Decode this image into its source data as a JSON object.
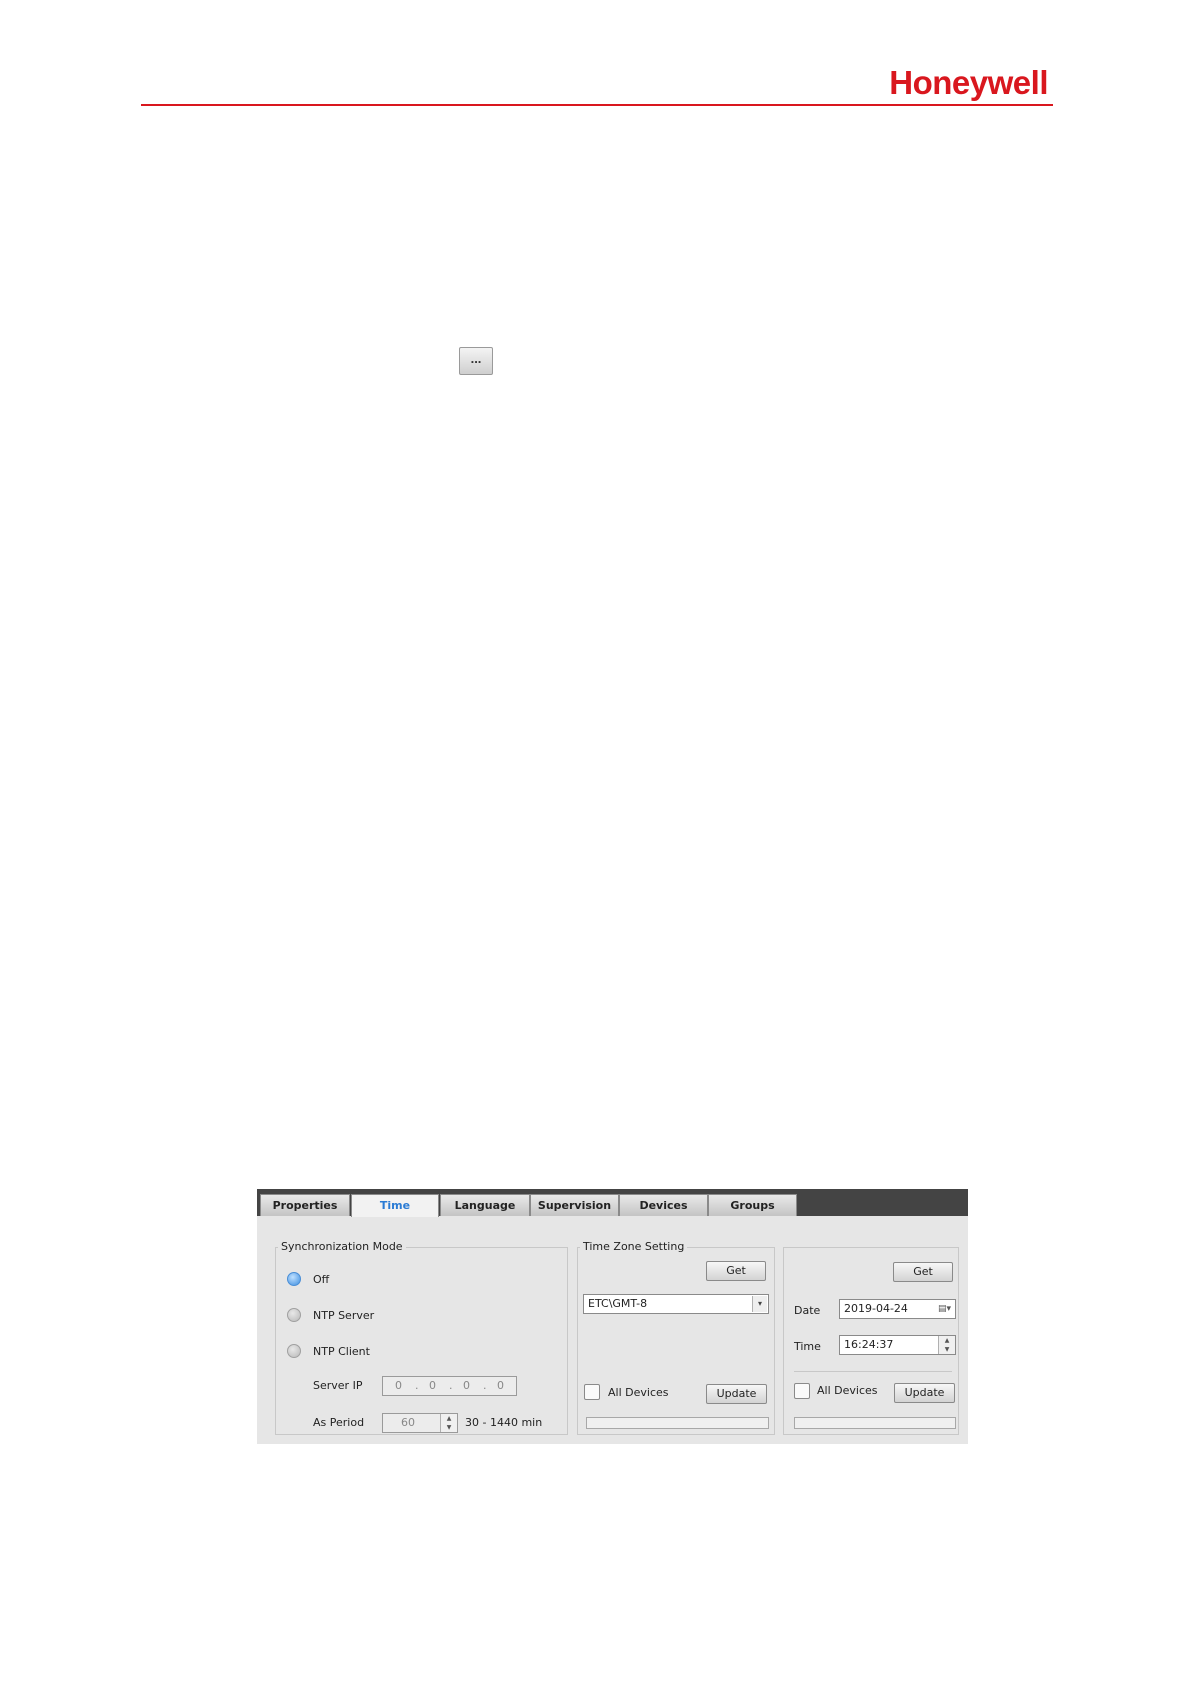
{
  "header": {
    "brand": "Honeywell",
    "accent_color": "#d9171e"
  },
  "browse_button": {
    "label": "..."
  },
  "dialog": {
    "tabs": [
      {
        "label": "Properties",
        "active": false
      },
      {
        "label": "Time",
        "active": true
      },
      {
        "label": "Language",
        "active": false
      },
      {
        "label": "Supervision",
        "active": false
      },
      {
        "label": "Devices",
        "active": false
      },
      {
        "label": "Groups",
        "active": false
      }
    ],
    "sync": {
      "legend": "Synchronization Mode",
      "options": [
        "Off",
        "NTP Server",
        "NTP Client"
      ],
      "selected": "Off",
      "server_ip_label": "Server IP",
      "server_ip_octets": [
        "0",
        "0",
        "0",
        "0"
      ],
      "server_ip_sep": ".",
      "as_period_label": "As Period",
      "as_period_value": "60",
      "as_period_range": "30 - 1440 min"
    },
    "timezone": {
      "legend": "Time Zone Setting",
      "get_label": "Get",
      "value": "ETC\\GMT-8",
      "all_devices_label": "All Devices",
      "update_label": "Update"
    },
    "datetime": {
      "get_label": "Get",
      "date_label": "Date",
      "date_value": "2019-04-24",
      "time_label": "Time",
      "time_value": "16:24:37",
      "all_devices_label": "All Devices",
      "update_label": "Update"
    }
  }
}
